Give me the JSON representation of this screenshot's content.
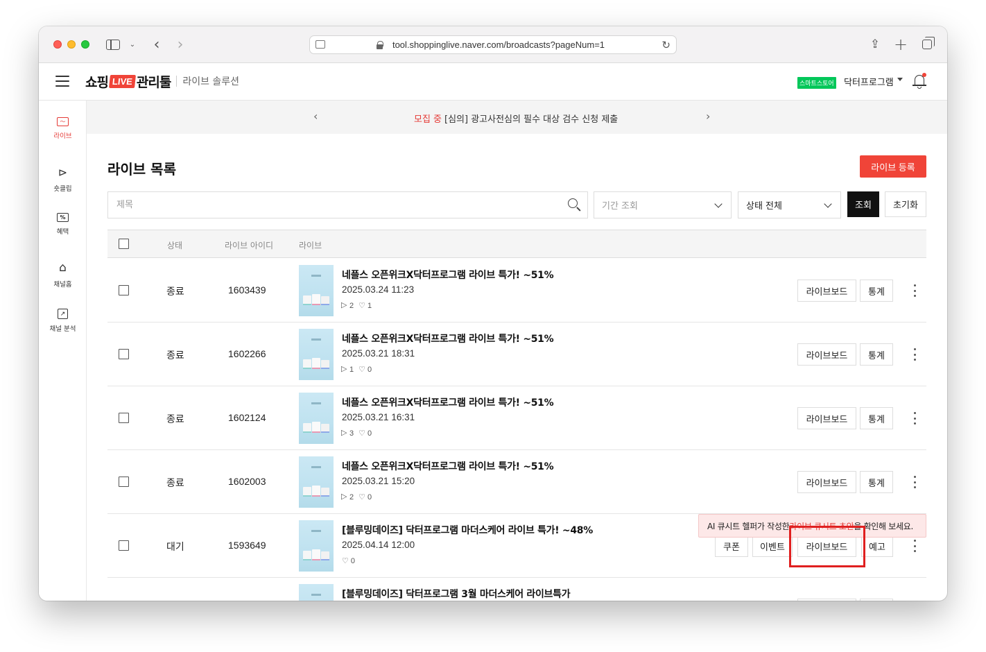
{
  "browser": {
    "url": "tool.shoppinglive.naver.com/broadcasts?pageNum=1"
  },
  "header": {
    "logo_shop": "쇼핑",
    "logo_live": "LIVE",
    "logo_manager": "관리툴",
    "subtitle": "라이브 솔루션",
    "store_badge": "스마트스토어",
    "store_name": "닥터프로그램"
  },
  "sidebar": {
    "items": [
      {
        "label": "라이브",
        "icon": "live-monitor-icon",
        "active": true
      },
      {
        "label": "숏클립",
        "icon": "shortclip-icon",
        "active": false
      },
      {
        "label": "혜택",
        "icon": "benefit-coupon-icon",
        "active": false
      },
      {
        "label": "채널홈",
        "icon": "home-icon",
        "active": false
      },
      {
        "label": "채널 분석",
        "icon": "chart-icon",
        "active": false
      }
    ]
  },
  "notice": {
    "tag": "모집 중",
    "text": "[심의] 광고사전심의 필수 대상 검수 신청 제출"
  },
  "main": {
    "title": "라이브 목록",
    "register_button": "라이브 등록",
    "search_placeholder": "제목",
    "period_placeholder": "기간 조회",
    "status_select": "상태 전체",
    "search_button": "조회",
    "reset_button": "초기화"
  },
  "table": {
    "headers": {
      "status": "상태",
      "live_id": "라이브 아이디",
      "live": "라이브"
    },
    "rows": [
      {
        "status": "종료",
        "id": "1603439",
        "title": "네플스 오픈위크X닥터프로그램 라이브 특가! ~51%",
        "date": "2025.03.24 11:23",
        "views": "2",
        "likes": "1"
      },
      {
        "status": "종료",
        "id": "1602266",
        "title": "네플스 오픈위크X닥터프로그램 라이브 특가! ~51%",
        "date": "2025.03.21 18:31",
        "views": "1",
        "likes": "0"
      },
      {
        "status": "종료",
        "id": "1602124",
        "title": "네플스 오픈위크X닥터프로그램 라이브 특가! ~51%",
        "date": "2025.03.21 16:31",
        "views": "3",
        "likes": "0"
      },
      {
        "status": "종료",
        "id": "1602003",
        "title": "네플스 오픈위크X닥터프로그램 라이브 특가! ~51%",
        "date": "2025.03.21 15:20",
        "views": "2",
        "likes": "0"
      },
      {
        "status": "대기",
        "id": "1593649",
        "title": "[블루밍데이즈] 닥터프로그램 마더스케어 라이브 특가! ~48%",
        "date": "2025.04.14 12:00",
        "likes": "0"
      },
      {
        "title": "[블루밍데이즈] 닥터프로그램 3월 마더스케어 라이브특가"
      }
    ],
    "buttons": {
      "board": "라이브보드",
      "stats": "통계",
      "coupon": "쿠폰",
      "event": "이벤트",
      "notice": "예고"
    }
  },
  "tooltip": {
    "before": "AI 큐시트 헬퍼가 작성한 ",
    "highlight": "라이브 큐시트 초안",
    "after": "을 확인해 보세요."
  }
}
